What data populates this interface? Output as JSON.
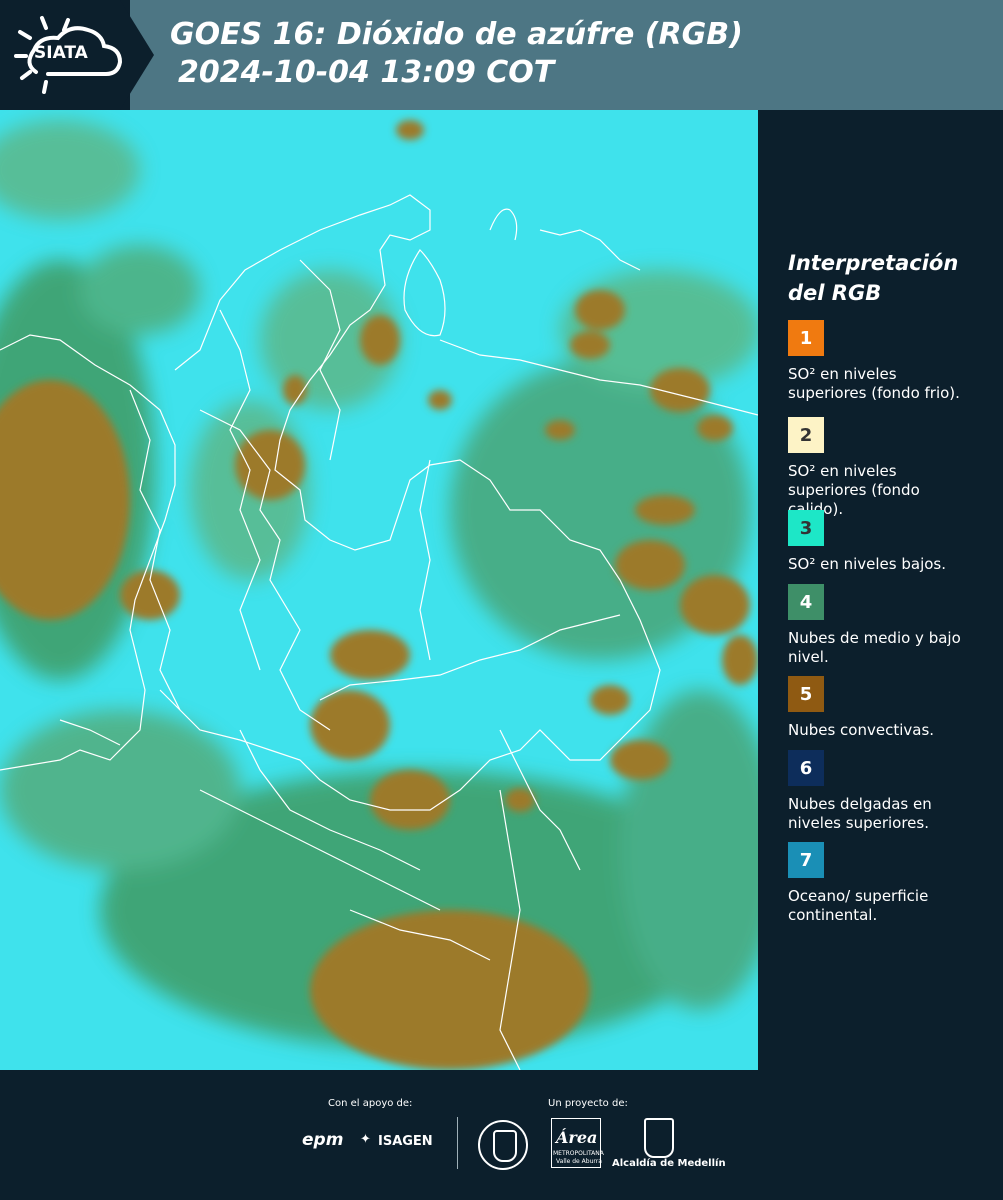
{
  "header": {
    "logo_text": "SIATA",
    "title": "GOES 16: Dióxido de azúfre (RGB)",
    "subtitle": "2024-10-04 13:09 COT"
  },
  "legend": {
    "title": "Interpretación del RGB",
    "items": [
      {
        "number": "1",
        "text": "SO² en niveles superiores (fondo frio).",
        "color": "#f07a10"
      },
      {
        "number": "2",
        "text": "SO² en niveles superiores (fondo calido).",
        "color": "#fdf3c6"
      },
      {
        "number": "3",
        "text": "SO² en niveles bajos.",
        "color": "#1de7c7"
      },
      {
        "number": "4",
        "text": "Nubes de medio y bajo nivel.",
        "color": "#3e8f68"
      },
      {
        "number": "5",
        "text": "Nubes convectivas.",
        "color": "#8f5a12"
      },
      {
        "number": "6",
        "text": "Nubes delgadas en niveles superiores.",
        "color": "#0d2d5b"
      },
      {
        "number": "7",
        "text": "Oceano/ superficie continental.",
        "color": "#1a8fb6"
      }
    ]
  },
  "map_colors": {
    "cyan_background": "#3fe2ec",
    "convective_brown": "#9c7a2a",
    "low_cloud_green": "#3f9b63",
    "borders": "#ffffff"
  },
  "footer": {
    "support_label": "Con el apoyo de:",
    "project_label": "Un proyecto de:",
    "sponsor_epm": "epm",
    "sponsor_isagen": "ISAGEN",
    "area_text": "Área",
    "area_sub": "METROPOLITANA",
    "area_sub2": "Valle de Aburrá",
    "alcaldia": "Alcaldía de Medellín"
  }
}
